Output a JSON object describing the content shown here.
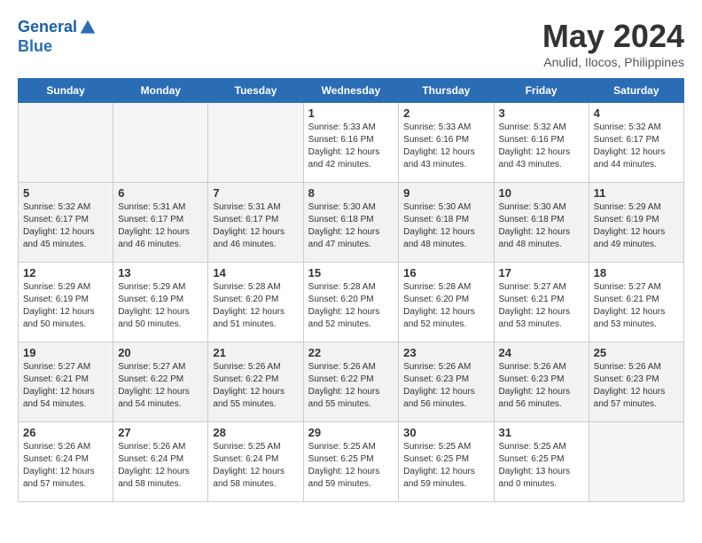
{
  "header": {
    "logo_line1": "General",
    "logo_line2": "Blue",
    "month_title": "May 2024",
    "location": "Anulid, Ilocos, Philippines"
  },
  "days_of_week": [
    "Sunday",
    "Monday",
    "Tuesday",
    "Wednesday",
    "Thursday",
    "Friday",
    "Saturday"
  ],
  "weeks": [
    [
      {
        "num": "",
        "info": ""
      },
      {
        "num": "",
        "info": ""
      },
      {
        "num": "",
        "info": ""
      },
      {
        "num": "1",
        "info": "Sunrise: 5:33 AM\nSunset: 6:16 PM\nDaylight: 12 hours\nand 42 minutes."
      },
      {
        "num": "2",
        "info": "Sunrise: 5:33 AM\nSunset: 6:16 PM\nDaylight: 12 hours\nand 43 minutes."
      },
      {
        "num": "3",
        "info": "Sunrise: 5:32 AM\nSunset: 6:16 PM\nDaylight: 12 hours\nand 43 minutes."
      },
      {
        "num": "4",
        "info": "Sunrise: 5:32 AM\nSunset: 6:17 PM\nDaylight: 12 hours\nand 44 minutes."
      }
    ],
    [
      {
        "num": "5",
        "info": "Sunrise: 5:32 AM\nSunset: 6:17 PM\nDaylight: 12 hours\nand 45 minutes."
      },
      {
        "num": "6",
        "info": "Sunrise: 5:31 AM\nSunset: 6:17 PM\nDaylight: 12 hours\nand 46 minutes."
      },
      {
        "num": "7",
        "info": "Sunrise: 5:31 AM\nSunset: 6:17 PM\nDaylight: 12 hours\nand 46 minutes."
      },
      {
        "num": "8",
        "info": "Sunrise: 5:30 AM\nSunset: 6:18 PM\nDaylight: 12 hours\nand 47 minutes."
      },
      {
        "num": "9",
        "info": "Sunrise: 5:30 AM\nSunset: 6:18 PM\nDaylight: 12 hours\nand 48 minutes."
      },
      {
        "num": "10",
        "info": "Sunrise: 5:30 AM\nSunset: 6:18 PM\nDaylight: 12 hours\nand 48 minutes."
      },
      {
        "num": "11",
        "info": "Sunrise: 5:29 AM\nSunset: 6:19 PM\nDaylight: 12 hours\nand 49 minutes."
      }
    ],
    [
      {
        "num": "12",
        "info": "Sunrise: 5:29 AM\nSunset: 6:19 PM\nDaylight: 12 hours\nand 50 minutes."
      },
      {
        "num": "13",
        "info": "Sunrise: 5:29 AM\nSunset: 6:19 PM\nDaylight: 12 hours\nand 50 minutes."
      },
      {
        "num": "14",
        "info": "Sunrise: 5:28 AM\nSunset: 6:20 PM\nDaylight: 12 hours\nand 51 minutes."
      },
      {
        "num": "15",
        "info": "Sunrise: 5:28 AM\nSunset: 6:20 PM\nDaylight: 12 hours\nand 52 minutes."
      },
      {
        "num": "16",
        "info": "Sunrise: 5:28 AM\nSunset: 6:20 PM\nDaylight: 12 hours\nand 52 minutes."
      },
      {
        "num": "17",
        "info": "Sunrise: 5:27 AM\nSunset: 6:21 PM\nDaylight: 12 hours\nand 53 minutes."
      },
      {
        "num": "18",
        "info": "Sunrise: 5:27 AM\nSunset: 6:21 PM\nDaylight: 12 hours\nand 53 minutes."
      }
    ],
    [
      {
        "num": "19",
        "info": "Sunrise: 5:27 AM\nSunset: 6:21 PM\nDaylight: 12 hours\nand 54 minutes."
      },
      {
        "num": "20",
        "info": "Sunrise: 5:27 AM\nSunset: 6:22 PM\nDaylight: 12 hours\nand 54 minutes."
      },
      {
        "num": "21",
        "info": "Sunrise: 5:26 AM\nSunset: 6:22 PM\nDaylight: 12 hours\nand 55 minutes."
      },
      {
        "num": "22",
        "info": "Sunrise: 5:26 AM\nSunset: 6:22 PM\nDaylight: 12 hours\nand 55 minutes."
      },
      {
        "num": "23",
        "info": "Sunrise: 5:26 AM\nSunset: 6:23 PM\nDaylight: 12 hours\nand 56 minutes."
      },
      {
        "num": "24",
        "info": "Sunrise: 5:26 AM\nSunset: 6:23 PM\nDaylight: 12 hours\nand 56 minutes."
      },
      {
        "num": "25",
        "info": "Sunrise: 5:26 AM\nSunset: 6:23 PM\nDaylight: 12 hours\nand 57 minutes."
      }
    ],
    [
      {
        "num": "26",
        "info": "Sunrise: 5:26 AM\nSunset: 6:24 PM\nDaylight: 12 hours\nand 57 minutes."
      },
      {
        "num": "27",
        "info": "Sunrise: 5:26 AM\nSunset: 6:24 PM\nDaylight: 12 hours\nand 58 minutes."
      },
      {
        "num": "28",
        "info": "Sunrise: 5:25 AM\nSunset: 6:24 PM\nDaylight: 12 hours\nand 58 minutes."
      },
      {
        "num": "29",
        "info": "Sunrise: 5:25 AM\nSunset: 6:25 PM\nDaylight: 12 hours\nand 59 minutes."
      },
      {
        "num": "30",
        "info": "Sunrise: 5:25 AM\nSunset: 6:25 PM\nDaylight: 12 hours\nand 59 minutes."
      },
      {
        "num": "31",
        "info": "Sunrise: 5:25 AM\nSunset: 6:25 PM\nDaylight: 13 hours\nand 0 minutes."
      },
      {
        "num": "",
        "info": ""
      }
    ]
  ]
}
